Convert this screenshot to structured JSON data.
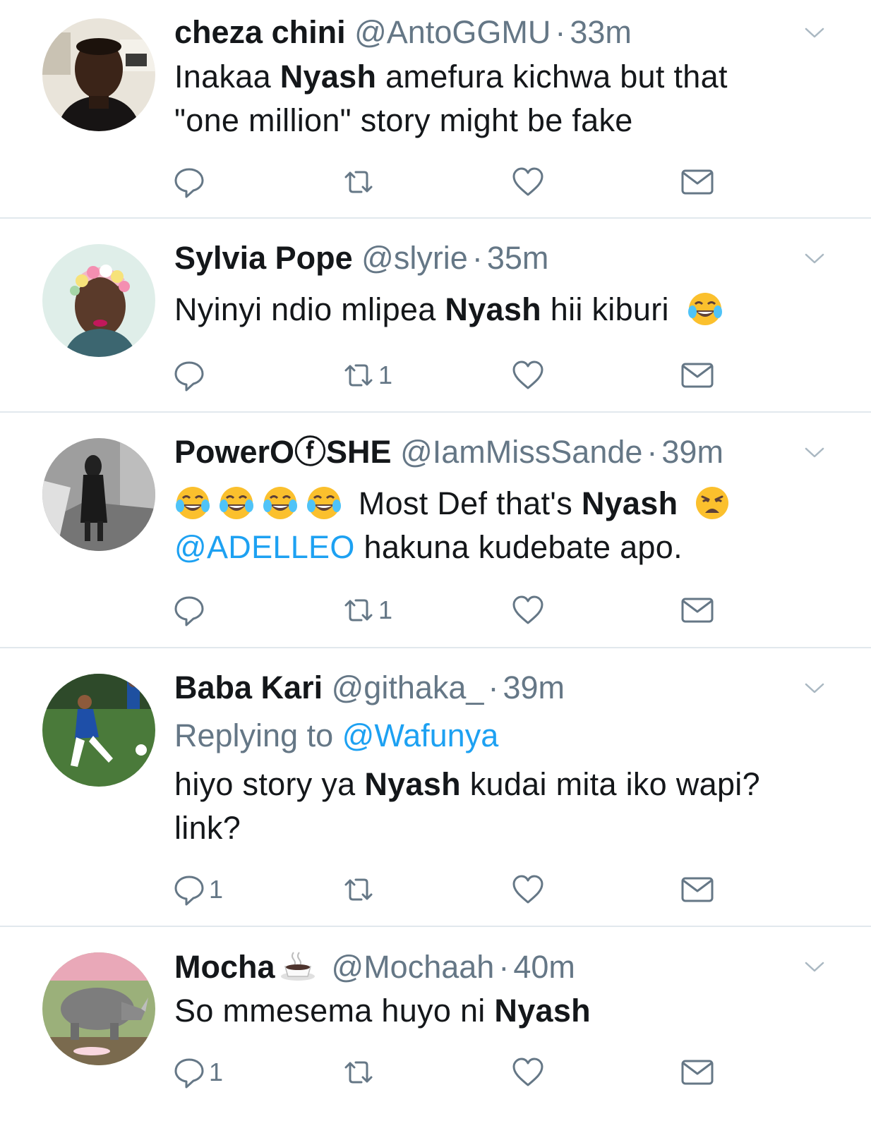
{
  "colors": {
    "text": "#14171a",
    "meta": "#657786",
    "link": "#1da1f2",
    "divider": "#e1e8ed"
  },
  "tweets": [
    {
      "display_name": "cheza chini",
      "handle": "@AntoGGMU",
      "dot": "·",
      "time": "33m",
      "text_parts": [
        "Inakaa ",
        "Nyash",
        " amefura kichwa but that",
        "\"one million\" story might be fake"
      ],
      "reply_count": "",
      "retweet_count": "",
      "avatar_icon": "avatar-man-photo"
    },
    {
      "display_name": "Sylvia Pope",
      "handle": "@slyrie",
      "dot": "·",
      "time": "35m",
      "text_parts": [
        "Nyinyi ndio mlipea ",
        "Nyash",
        " hii kiburi"
      ],
      "emoji": "face-with-tears-of-joy",
      "reply_count": "",
      "retweet_count": "1",
      "avatar_icon": "avatar-woman-flower-crown-photo"
    },
    {
      "display_name": "PowerOⓕSHE",
      "handle": "@IamMissSande",
      "dot": "·",
      "time": "39m",
      "text_parts": [
        " Most Def that's ",
        "Nyash",
        "@ADELLEO",
        " hakuna kudebate apo."
      ],
      "emojis": [
        "face-with-tears-of-joy",
        "face-with-tears-of-joy",
        "face-with-tears-of-joy",
        "face-with-tears-of-joy",
        "weary-face"
      ],
      "reply_count": "",
      "retweet_count": "1",
      "avatar_icon": "avatar-bw-figure-photo"
    },
    {
      "display_name": "Baba Kari",
      "handle": "@githaka_",
      "dot": "·",
      "time": "39m",
      "replying_label": "Replying to ",
      "replying_to": "@Wafunya",
      "text_parts": [
        "hiyo story ya ",
        "Nyash",
        " kudai mita iko wapi?",
        "link?"
      ],
      "reply_count": "1",
      "retweet_count": "",
      "avatar_icon": "avatar-football-player-photo"
    },
    {
      "display_name": "Mocha",
      "name_emoji": "hot-coffee-cup",
      "handle": "@Mochaah",
      "dot": "·",
      "time": "40m",
      "text_parts": [
        "So mmesema huyo ni ",
        "Nyash"
      ],
      "reply_count": "1",
      "retweet_count": "",
      "avatar_icon": "avatar-rhino-photo"
    }
  ]
}
